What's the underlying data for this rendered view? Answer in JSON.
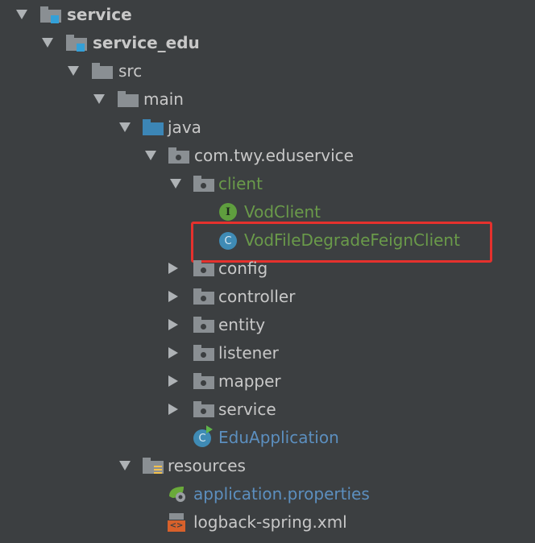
{
  "tree": {
    "service": "service",
    "service_edu": "service_edu",
    "src": "src",
    "main": "main",
    "java": "java",
    "package": "com.twy.eduservice",
    "client": "client",
    "vod_client": "VodClient",
    "vod_client_badge": "I",
    "vod_degrade": "VodFileDegradeFeignClient",
    "vod_degrade_badge": "C",
    "config": "config",
    "controller": "controller",
    "entity": "entity",
    "listener": "listener",
    "mapper": "mapper",
    "service_pkg": "service",
    "edu_app": "EduApplication",
    "edu_app_badge": "C",
    "resources": "resources",
    "app_props": "application.properties",
    "logback": "logback-spring.xml",
    "logback_badge": "<>"
  },
  "colors": {
    "background": "#3c3f41",
    "highlight_border": "#e5312d",
    "modified_green": "#6a9a4a",
    "new_blue": "#5c8fbf"
  }
}
